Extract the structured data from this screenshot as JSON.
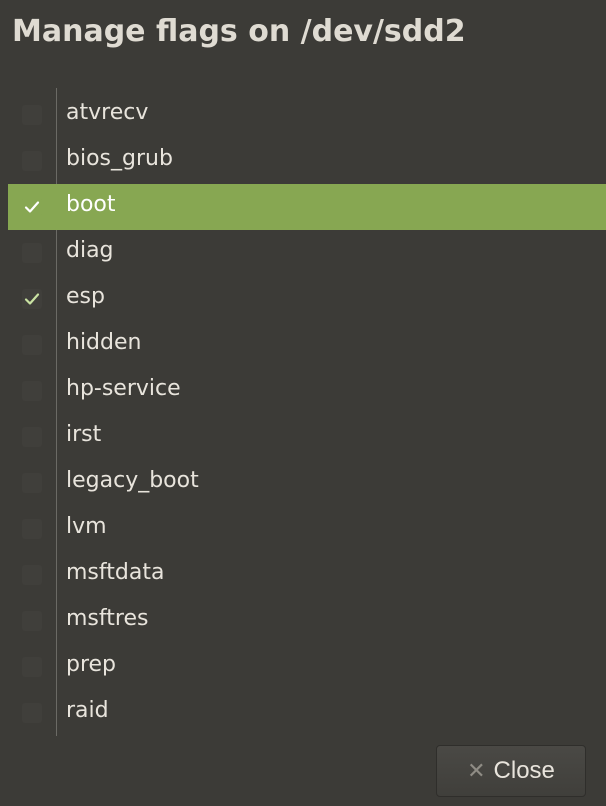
{
  "dialog": {
    "title": "Manage flags on /dev/sdd2"
  },
  "flags": [
    {
      "label": "atvrecv",
      "checked": false
    },
    {
      "label": "bios_grub",
      "checked": false
    },
    {
      "label": "boot",
      "checked": true,
      "selected": true
    },
    {
      "label": "diag",
      "checked": false
    },
    {
      "label": "esp",
      "checked": true
    },
    {
      "label": "hidden",
      "checked": false
    },
    {
      "label": "hp-service",
      "checked": false
    },
    {
      "label": "irst",
      "checked": false
    },
    {
      "label": "legacy_boot",
      "checked": false
    },
    {
      "label": "lvm",
      "checked": false
    },
    {
      "label": "msftdata",
      "checked": false
    },
    {
      "label": "msftres",
      "checked": false
    },
    {
      "label": "prep",
      "checked": false
    },
    {
      "label": "raid",
      "checked": false
    }
  ],
  "footer": {
    "close_label": "Close",
    "close_icon": "close-icon"
  },
  "colors": {
    "background": "#3c3b37",
    "selection": "#87a752",
    "text": "#e8e4dc"
  }
}
